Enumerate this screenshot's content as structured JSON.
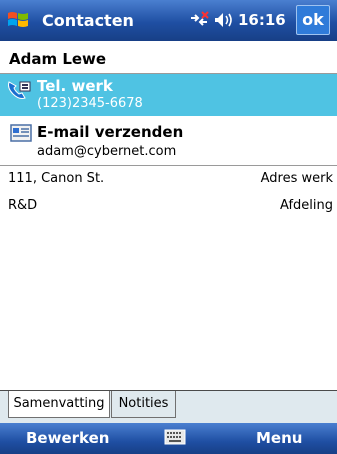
{
  "titlebar": {
    "title": "Contacten",
    "time": "16:16",
    "ok_label": "ok",
    "icons": [
      "windows-start-icon",
      "connectivity-icon",
      "volume-icon"
    ]
  },
  "contact": {
    "name": "Adam Lewe"
  },
  "phone": {
    "label": "Tel. werk",
    "value": "(123)2345-6678",
    "icon": "phone-work-icon"
  },
  "email": {
    "label": "E-mail verzenden",
    "value": "adam@cybernet.com",
    "icon": "email-icon"
  },
  "details": [
    {
      "value": "111, Canon St.",
      "label": "Adres werk"
    },
    {
      "value": "R&D",
      "label": "Afdeling"
    }
  ],
  "tabs": [
    {
      "label": "Samenvatting",
      "active": true
    },
    {
      "label": "Notities",
      "active": false
    }
  ],
  "menubar": {
    "left_softkey": "Bewerken",
    "right_softkey": "Menu",
    "center_icon": "keyboard-icon"
  },
  "colors": {
    "titlebar": "#1f4fa3",
    "selection": "#4fc3e3",
    "tab_bg": "#dfe9ee"
  }
}
